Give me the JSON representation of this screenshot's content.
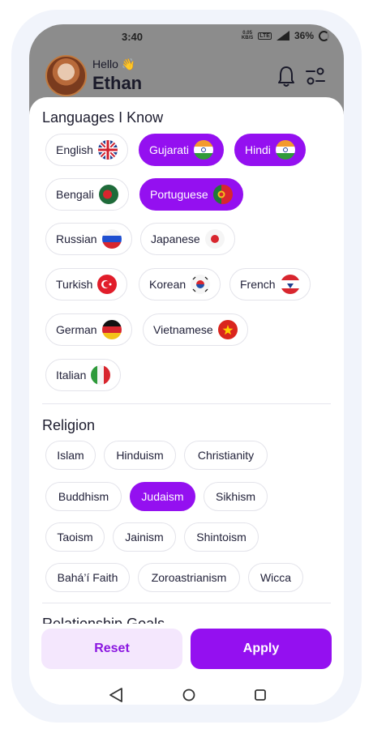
{
  "status": {
    "time": "3:40",
    "speed_top": "0.05",
    "speed_bottom": "KB/S",
    "network": "LTE",
    "signal": "4G",
    "battery": "36%"
  },
  "header": {
    "greeting": "Hello 👋",
    "name": "Ethan"
  },
  "languages": {
    "title": "Languages I Know",
    "items": [
      {
        "label": "English",
        "flag": "uk-flag-icon",
        "selected": false
      },
      {
        "label": "Gujarati",
        "flag": "india-flag-icon",
        "selected": true
      },
      {
        "label": "Hindi",
        "flag": "india-flag-icon",
        "selected": true
      },
      {
        "label": "Bengali",
        "flag": "bangladesh-flag-icon",
        "selected": false
      },
      {
        "label": "Portuguese",
        "flag": "portugal-flag-icon",
        "selected": true
      },
      {
        "label": "Russian",
        "flag": "russia-flag-icon",
        "selected": false
      },
      {
        "label": "Japanese",
        "flag": "japan-flag-icon",
        "selected": false
      },
      {
        "label": "Turkish",
        "flag": "turkey-flag-icon",
        "selected": false
      },
      {
        "label": "Korean",
        "flag": "korea-flag-icon",
        "selected": false
      },
      {
        "label": "French",
        "flag": "france-flag-icon",
        "selected": false
      },
      {
        "label": "German",
        "flag": "germany-flag-icon",
        "selected": false
      },
      {
        "label": "Vietnamese",
        "flag": "vietnam-flag-icon",
        "selected": false
      },
      {
        "label": "Italian",
        "flag": "italy-flag-icon",
        "selected": false
      }
    ]
  },
  "religion": {
    "title": "Religion",
    "items": [
      {
        "label": "Islam",
        "selected": false
      },
      {
        "label": "Hinduism",
        "selected": false
      },
      {
        "label": "Christianity",
        "selected": false
      },
      {
        "label": "Buddhism",
        "selected": false
      },
      {
        "label": "Judaism",
        "selected": true
      },
      {
        "label": "Sikhism",
        "selected": false
      },
      {
        "label": "Taoism",
        "selected": false
      },
      {
        "label": "Jainism",
        "selected": false
      },
      {
        "label": "Shintoism",
        "selected": false
      },
      {
        "label": "Bahá’í Faith",
        "selected": false
      },
      {
        "label": "Zoroastrianism",
        "selected": false
      },
      {
        "label": "Wicca",
        "selected": false
      }
    ]
  },
  "next_section_peek": "Relationship Goals",
  "actions": {
    "reset_label": "Reset",
    "apply_label": "Apply"
  },
  "colors": {
    "accent": "#9410f0",
    "reset_bg": "#f4e7fd"
  }
}
